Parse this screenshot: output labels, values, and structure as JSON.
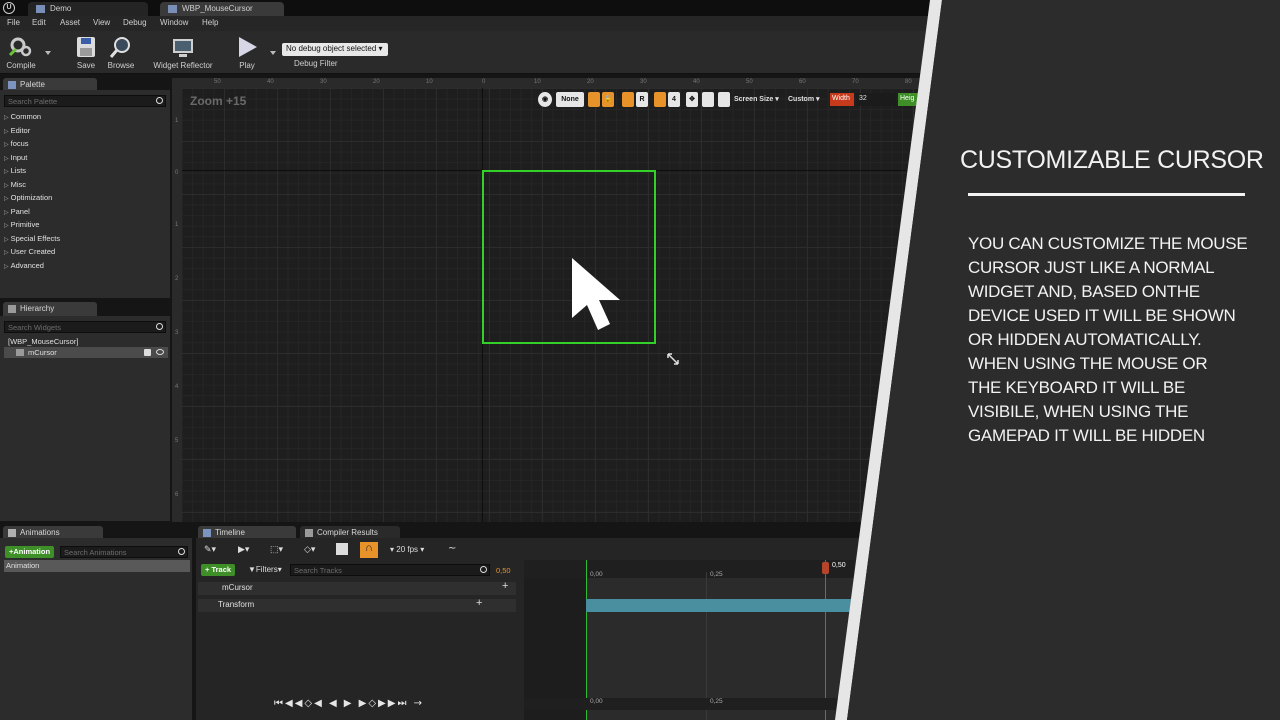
{
  "window": {
    "tabs": [
      "Demo",
      "WBP_MouseCursor"
    ]
  },
  "menu": [
    "File",
    "Edit",
    "Asset",
    "View",
    "Debug",
    "Window",
    "Help"
  ],
  "toolbar": {
    "compile": "Compile",
    "save": "Save",
    "browse": "Browse",
    "widget_reflector": "Widget Reflector",
    "play": "Play",
    "debug_dropdown": "No debug object selected",
    "debug_filter": "Debug Filter"
  },
  "palette": {
    "tab": "Palette",
    "search_placeholder": "Search Palette",
    "categories": [
      "Common",
      "Editor",
      "focus",
      "Input",
      "Lists",
      "Misc",
      "Optimization",
      "Panel",
      "Primitive",
      "Special Effects",
      "User Created",
      "Advanced"
    ]
  },
  "hierarchy": {
    "tab": "Hierarchy",
    "search_placeholder": "Search Widgets",
    "root": "[WBP_MouseCursor]",
    "child": "mCursor"
  },
  "designer": {
    "zoom": "Zoom +15",
    "none_label": "None",
    "r_label": "R",
    "num_label": "4",
    "screen_size": "Screen Size",
    "custom": "Custom",
    "width_label": "Width",
    "width_value": "32",
    "height_label": "Heig",
    "ruler_top": [
      "50",
      "40",
      "30",
      "20",
      "10",
      "0",
      "10",
      "20",
      "30",
      "40",
      "50",
      "60",
      "70",
      "80"
    ],
    "ruler_left": [
      "1",
      "0",
      "1",
      "2",
      "3",
      "4",
      "5",
      "6"
    ]
  },
  "animations": {
    "tab": "Animations",
    "add_button": "+Animation",
    "search_placeholder": "Search Animations",
    "item": "Animation"
  },
  "timeline": {
    "tab": "Timeline",
    "compiler_tab": "Compiler Results",
    "fps": "20 fps",
    "track_button": "+ Track",
    "filters": "Filters",
    "search_placeholder": "Search Tracks",
    "time_value": "0,50",
    "tracks": [
      "mCursor",
      "Transform"
    ],
    "ticks": [
      "0,00",
      "0,25",
      "0,50"
    ],
    "bottom_ticks": [
      "0,00",
      "0,25"
    ]
  },
  "promo": {
    "title": "CUSTOMIZABLE CURSOR",
    "body_lines": [
      "YOU CAN CUSTOMIZE THE MOUSE",
      "CURSOR JUST  LIKE A NORMAL",
      "WIDGET AND, BASED ONTHE",
      "DEVICE USED IT WILL BE SHOWN",
      "OR HIDDEN AUTOMATICALLY.",
      "WHEN USING THE MOUSE OR",
      "THE KEYBOARD IT WILL BE",
      "VISIBILE, WHEN USING THE",
      "GAMEPAD IT WILL BE HIDDEN"
    ]
  },
  "colors": {
    "widget_outline": "#33d02a",
    "accent_orange": "#e8922a",
    "green_button": "#3f8f28",
    "track_bar": "#4a8fa0"
  }
}
